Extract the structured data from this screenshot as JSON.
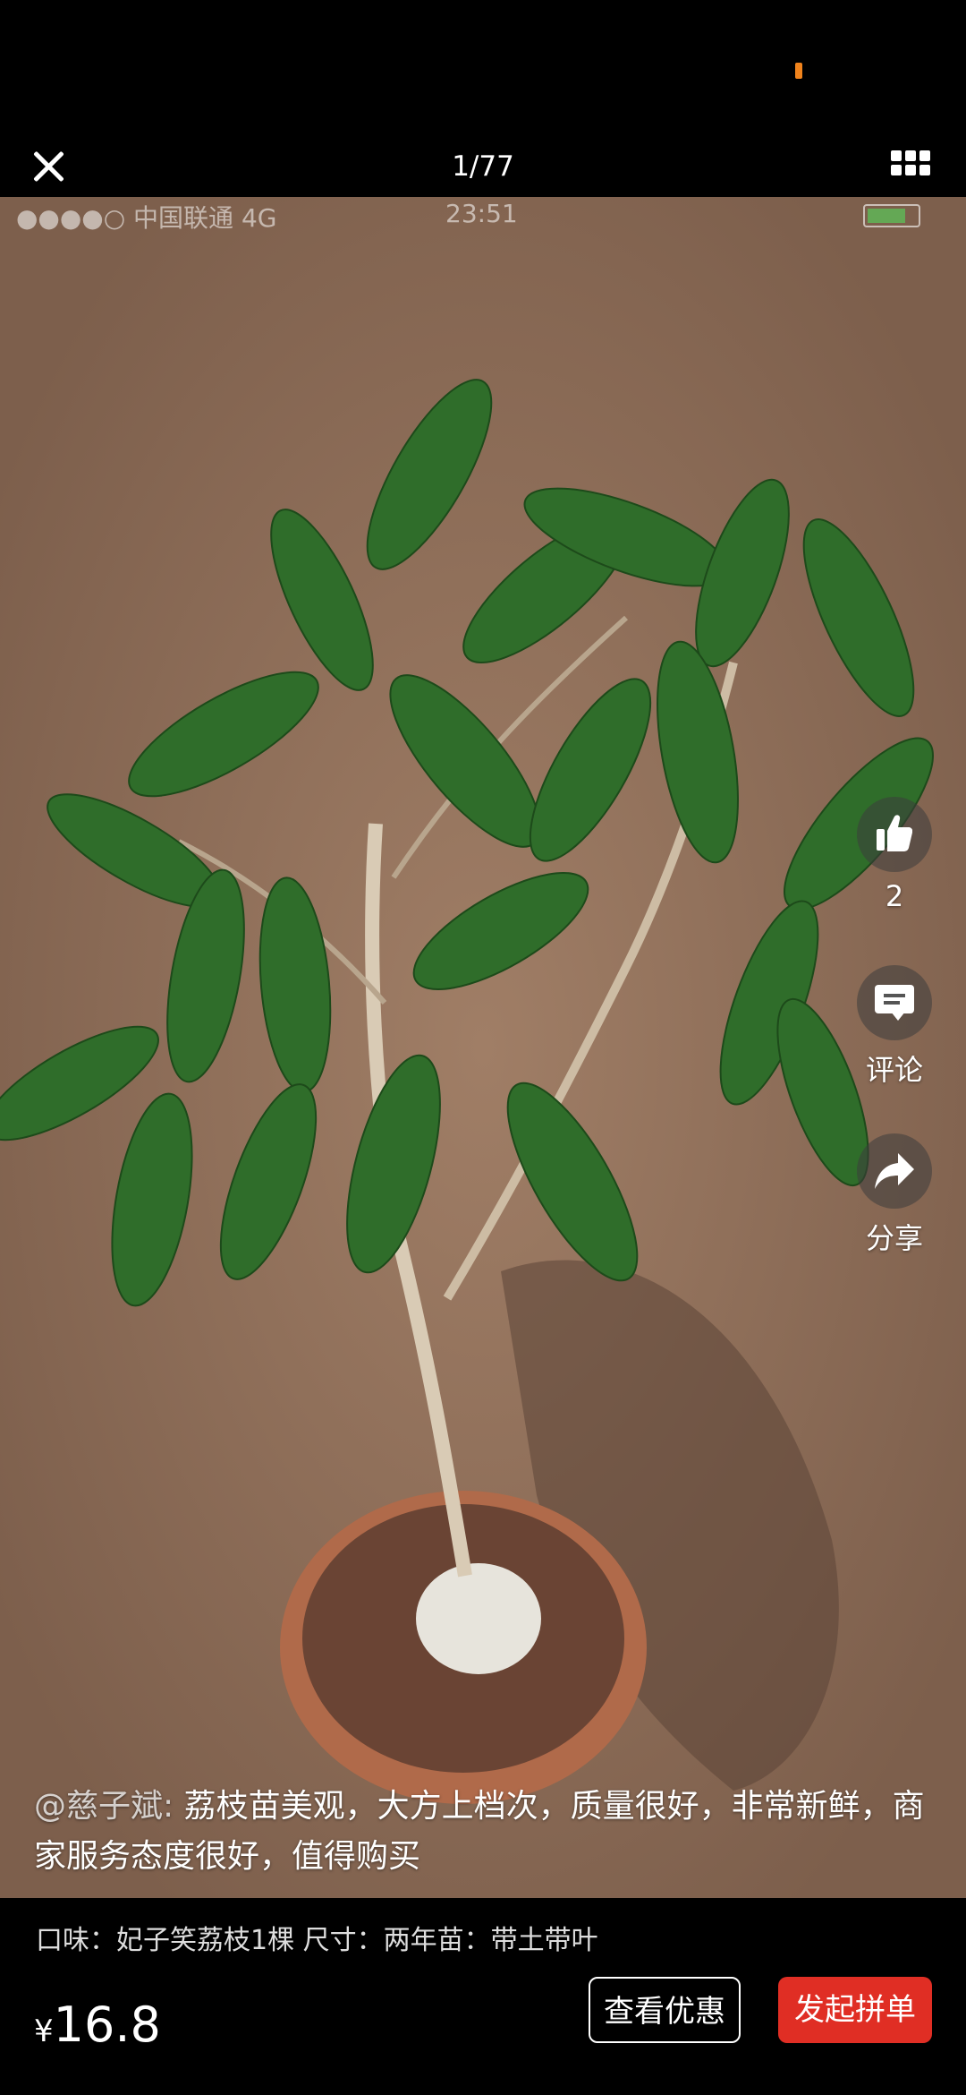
{
  "header": {
    "page_counter": "1/77",
    "close_icon": "close-icon",
    "grid_icon": "grid-icon"
  },
  "photo": {
    "status_carrier": "●●●●○ 中国联通 4G",
    "status_time": "23:51"
  },
  "actions": {
    "like_count": "2",
    "comment_label": "评论",
    "share_label": "分享"
  },
  "review": {
    "user": "@慈子斌:",
    "text": "荔枝苗美观，大方上档次，质量很好，非常新鲜，商家服务态度很好，值得购买"
  },
  "product": {
    "spec": "口味：妃子笑荔枝1棵  尺寸：两年苗：带土带叶",
    "currency": "¥",
    "price": "16.8",
    "coupon_button": "查看优惠",
    "group_button": "发起拼单"
  },
  "colors": {
    "accent_red": "#e02e24",
    "status_orange": "#f0831c"
  }
}
